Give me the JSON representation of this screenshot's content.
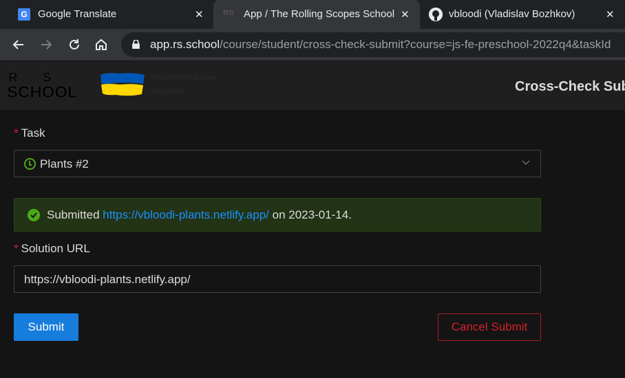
{
  "browser": {
    "tabs": [
      {
        "title": "Google Translate",
        "icon": "google-translate-icon",
        "active": false
      },
      {
        "title": "App / The Rolling Scopes School",
        "icon": "rs-school-icon",
        "active": true
      },
      {
        "title": "vbloodi (Vladislav Bozhkov)",
        "icon": "github-icon",
        "active": false
      }
    ],
    "close_glyph": "✕",
    "url_host": "app.rs.school",
    "url_path": "/course/student/cross-check-submit?course=js-fe-preschool-2022q4&taskId"
  },
  "header": {
    "logo_letters": {
      "r": "R",
      "s": "S",
      "school": "SCHOOL"
    },
    "stand_lines": [
      "#StandWithUkraine",
      "#StopWar"
    ],
    "page_title": "Cross-Check Sub"
  },
  "form": {
    "task_label": "Task",
    "required_mark": "*",
    "task_value": "Plants #2",
    "alert": {
      "prefix": "Submitted",
      "link": "https://vbloodi-plants.netlify.app/",
      "suffix": "on 2023-01-14."
    },
    "solution_label": "Solution URL",
    "solution_value": "https://vbloodi-plants.netlify.app/",
    "submit_label": "Submit",
    "cancel_label": "Cancel Submit"
  },
  "colors": {
    "primary": "#177ddc",
    "success": "#49aa19",
    "danger": "#d32029",
    "link": "#1890ff"
  }
}
